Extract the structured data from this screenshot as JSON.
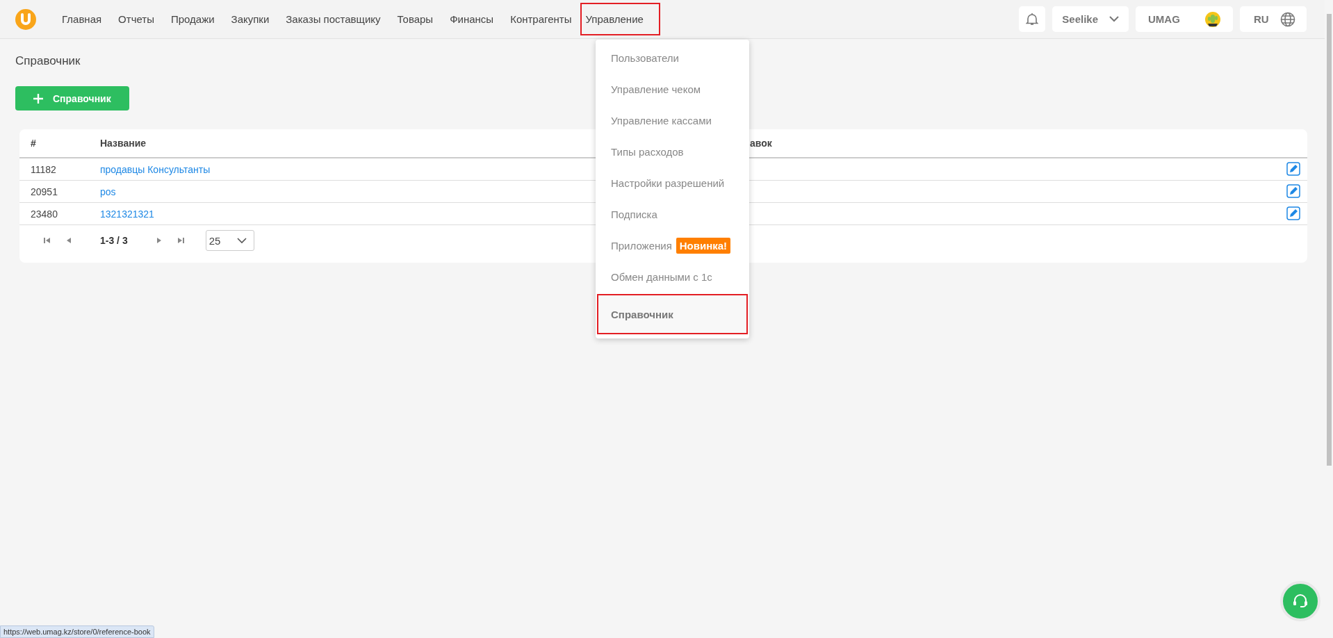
{
  "nav": [
    {
      "label": "Главная",
      "highlighted": false
    },
    {
      "label": "Отчеты",
      "highlighted": false
    },
    {
      "label": "Продажи",
      "highlighted": false
    },
    {
      "label": "Закупки",
      "highlighted": false
    },
    {
      "label": "Заказы поставщику",
      "highlighted": false
    },
    {
      "label": "Товары",
      "highlighted": false
    },
    {
      "label": "Финансы",
      "highlighted": false
    },
    {
      "label": "Контрагенты",
      "highlighted": false
    },
    {
      "label": "Управление",
      "highlighted": true
    }
  ],
  "header": {
    "store": "Seelike",
    "account": "UMAG",
    "language": "RU"
  },
  "page_title": "Справочник",
  "add_button": "Справочник",
  "table": {
    "columns": [
      "#",
      "Название",
      "авок"
    ],
    "rows": [
      {
        "id": "11182",
        "name": "продавцы Консультанты"
      },
      {
        "id": "20951",
        "name": "pos"
      },
      {
        "id": "23480",
        "name": "1321321321"
      }
    ]
  },
  "pagination": {
    "range": "1-3 / 3",
    "page_size": "25"
  },
  "dropdown": [
    {
      "label": "Пользователи",
      "selected": false,
      "highlighted": false
    },
    {
      "label": "Управление чеком",
      "selected": false,
      "highlighted": false
    },
    {
      "label": "Управление кассами",
      "selected": false,
      "highlighted": false
    },
    {
      "label": "Типы расходов",
      "selected": false,
      "highlighted": false
    },
    {
      "label": "Настройки разрешений",
      "selected": false,
      "highlighted": false
    },
    {
      "label": "Подписка",
      "selected": false,
      "highlighted": false
    },
    {
      "label": "Приложения",
      "badge": "Новинка!",
      "selected": false,
      "highlighted": false
    },
    {
      "label": "Обмен данными с 1с",
      "selected": false,
      "highlighted": false
    },
    {
      "label": "Справочник",
      "selected": true,
      "highlighted": true
    }
  ],
  "status_url": "https://web.umag.kz/store/0/reference-book"
}
